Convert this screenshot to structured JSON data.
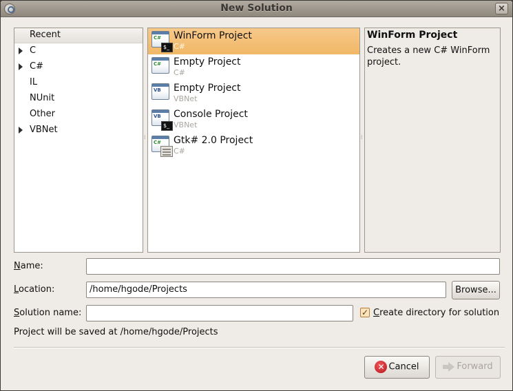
{
  "window": {
    "title": "New Solution",
    "close_glyph": "×"
  },
  "categories": {
    "header": "Recent",
    "items": [
      {
        "label": "C",
        "expandable": true
      },
      {
        "label": "C#",
        "expandable": true
      },
      {
        "label": "IL",
        "expandable": false
      },
      {
        "label": "NUnit",
        "expandable": false
      },
      {
        "label": "Other",
        "expandable": false
      },
      {
        "label": "VBNet",
        "expandable": true
      }
    ]
  },
  "templates": [
    {
      "name": "WinForm Project",
      "lang": "C#",
      "icon": "csharp-console-project-icon",
      "badge": "C#",
      "selected": true
    },
    {
      "name": "Empty Project",
      "lang": "C#",
      "icon": "csharp-project-icon",
      "badge": "C#"
    },
    {
      "name": "Empty Project",
      "lang": "VBNet",
      "icon": "vbnet-project-icon",
      "badge": "VB"
    },
    {
      "name": "Console Project",
      "lang": "VBNet",
      "icon": "vbnet-console-project-icon",
      "badge": "VB"
    },
    {
      "name": "Gtk# 2.0 Project",
      "lang": "C#",
      "icon": "csharp-gtk-project-icon",
      "badge": "C#"
    }
  ],
  "description": {
    "title": "WinForm Project",
    "text": "Creates a new C# WinForm project."
  },
  "form": {
    "name_label": "Name:",
    "name_value": "",
    "location_label": "Location:",
    "location_value": "/home/hgode/Projects",
    "browse_label": "Browse...",
    "solution_label": "Solution name:",
    "solution_value": "",
    "create_dir_label": "Create directory for solution",
    "create_dir_checked": true,
    "save_info": "Project will be saved at /home/hgode/Projects"
  },
  "buttons": {
    "cancel": "Cancel",
    "forward": "Forward"
  },
  "console_glyph": "$_",
  "checkmark": "✓",
  "cancel_glyph": "✕"
}
